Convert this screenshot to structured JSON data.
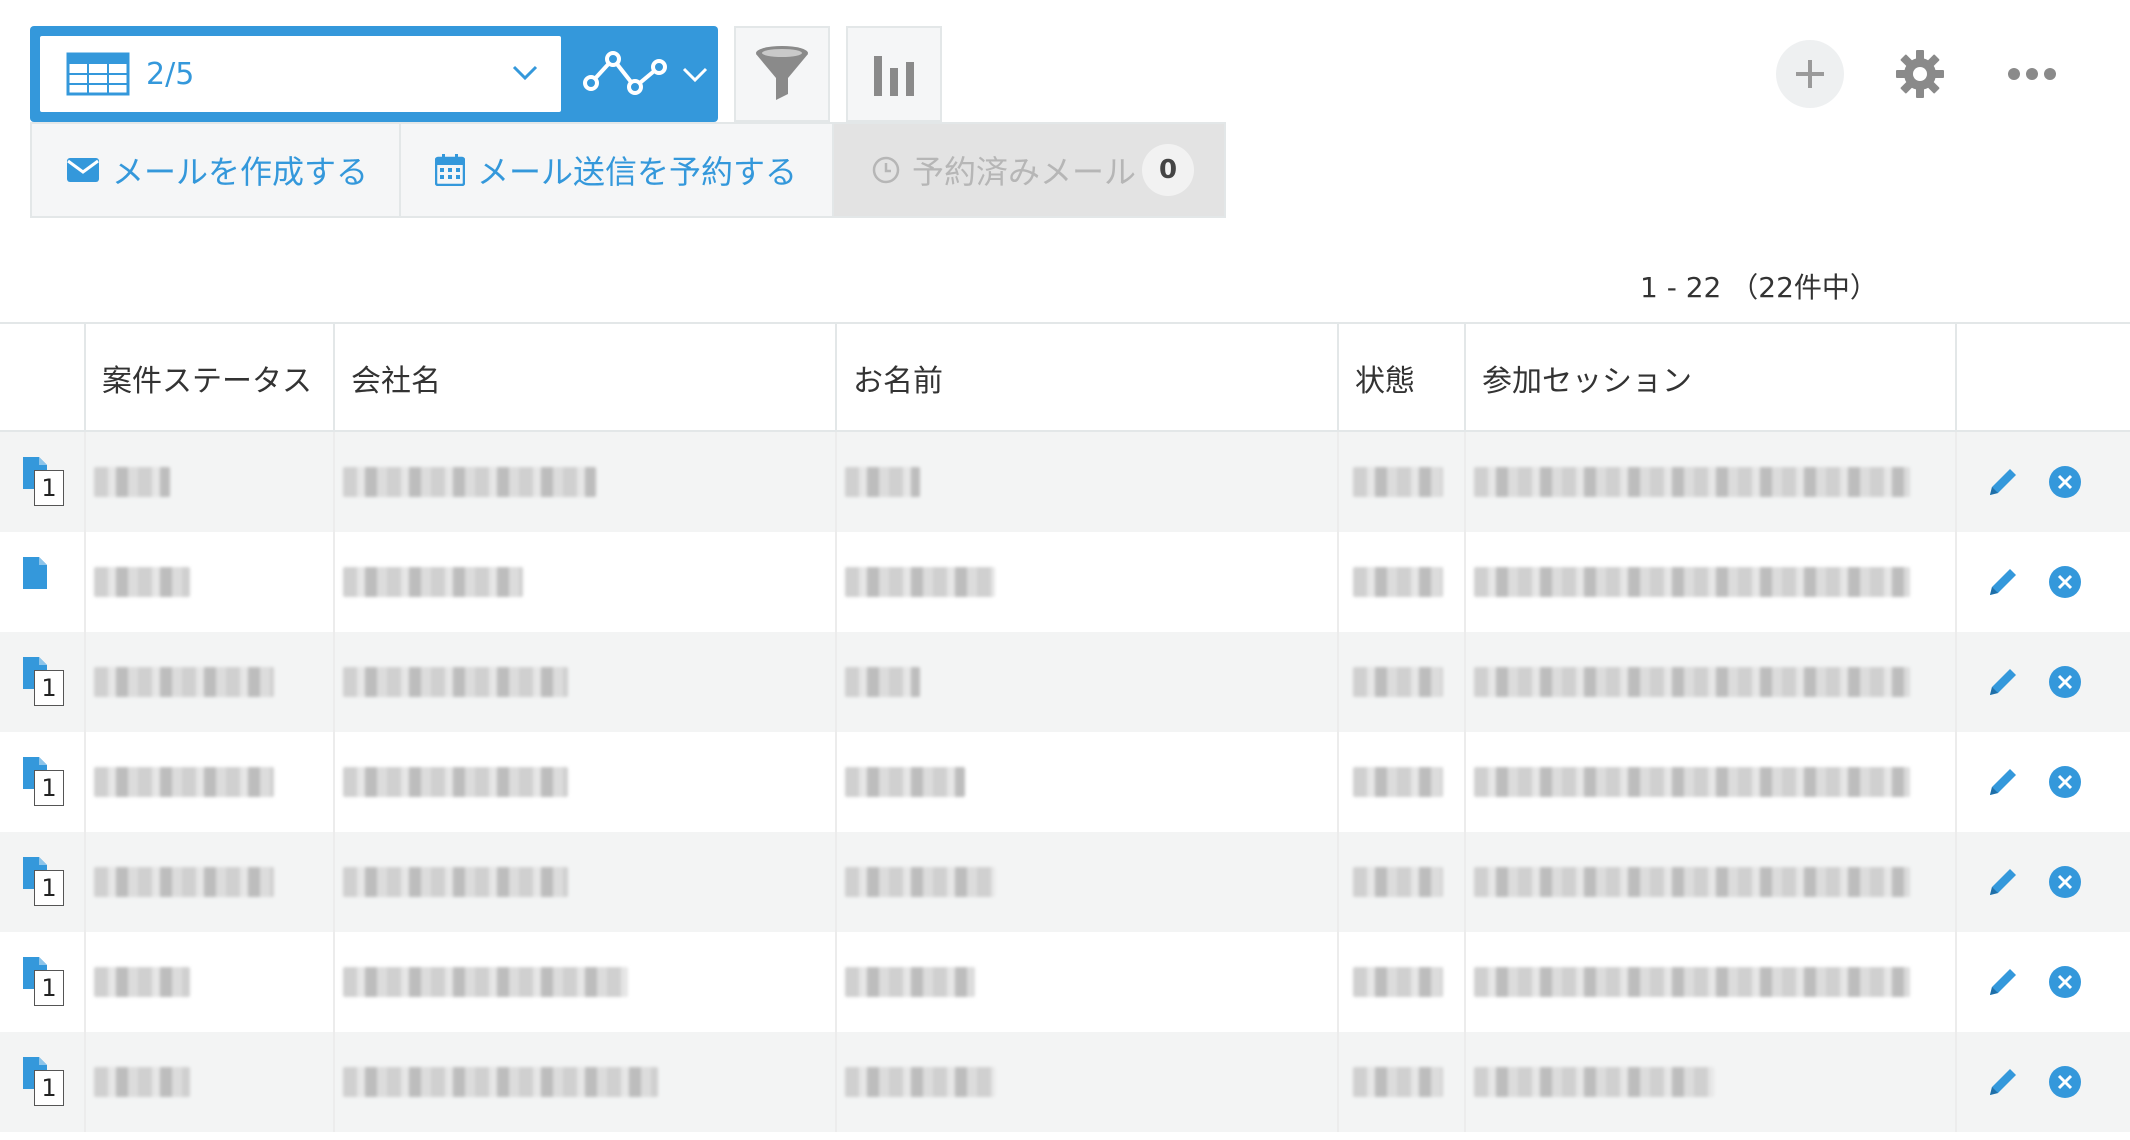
{
  "view_selector": {
    "current_view": "2/5",
    "accent_color": "#3498db"
  },
  "toolbar": {
    "icons": [
      "filter-icon",
      "graph-icon",
      "add-icon",
      "gear-icon",
      "more-icon"
    ]
  },
  "mail": {
    "compose_label": "メールを作成する",
    "schedule_label": "メール送信を予約する",
    "scheduled_label": "予約済みメール",
    "scheduled_count": "0"
  },
  "pagination": {
    "text": "1 - 22 （22件中）"
  },
  "table": {
    "columns": [
      "案件ステータス",
      "会社名",
      "お名前",
      "状態",
      "参加セッション"
    ],
    "rows": [
      {
        "thread_count": "1"
      },
      {
        "thread_count": ""
      },
      {
        "thread_count": "1"
      },
      {
        "thread_count": "1"
      },
      {
        "thread_count": "1"
      },
      {
        "thread_count": "1"
      },
      {
        "thread_count": "1"
      }
    ]
  }
}
